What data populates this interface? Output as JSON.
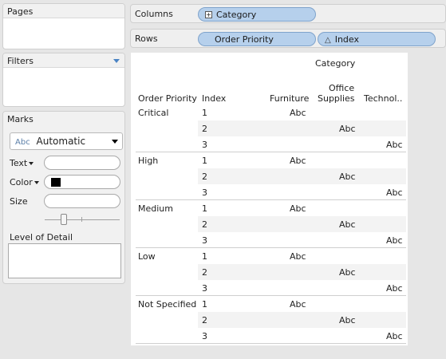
{
  "pages": {
    "title": "Pages"
  },
  "filters": {
    "title": "Filters"
  },
  "marks": {
    "title": "Marks",
    "mark_type": "Automatic",
    "mark_type_icon": "Abc",
    "text_label": "Text",
    "color_label": "Color",
    "color_value": "#000000",
    "size_label": "Size",
    "level_of_detail_label": "Level of Detail"
  },
  "columns": {
    "label": "Columns",
    "pill": "Category"
  },
  "rows": {
    "label": "Rows",
    "pills": [
      "Order Priority",
      "Index"
    ]
  },
  "viz": {
    "category_header": "Category",
    "row_header_1": "Order Priority",
    "row_header_2": "Index",
    "col_headers": [
      "Furniture",
      "Office\nSupplies",
      "Technol.."
    ],
    "col_header_office_line1": "Office",
    "col_header_office_line2": "Supplies",
    "mark_text": "Abc",
    "groups": [
      {
        "name": "Critical",
        "indices": [
          "1",
          "2",
          "3"
        ]
      },
      {
        "name": "High",
        "indices": [
          "1",
          "2",
          "3"
        ]
      },
      {
        "name": "Medium",
        "indices": [
          "1",
          "2",
          "3"
        ]
      },
      {
        "name": "Low",
        "indices": [
          "1",
          "2",
          "3"
        ]
      },
      {
        "name": "Not Specified",
        "indices": [
          "1",
          "2",
          "3"
        ]
      }
    ]
  }
}
